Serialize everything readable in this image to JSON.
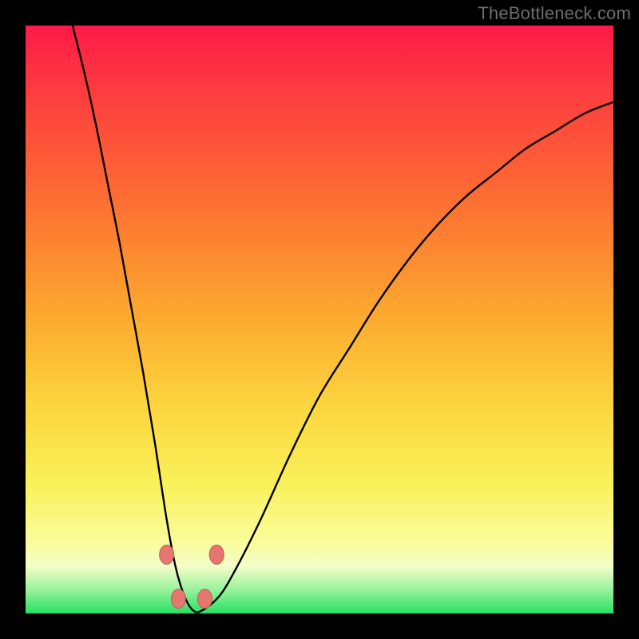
{
  "watermark": "TheBottleneck.com",
  "colors": {
    "background": "#000000",
    "gradient_top": "#fd1a48",
    "gradient_mid1": "#fd6f32",
    "gradient_mid2": "#fcd63f",
    "gradient_mid3": "#fafc9c",
    "gradient_bottom": "#26e062",
    "curve": "#000000",
    "marker_fill": "#e5776f",
    "marker_stroke": "#c25a54"
  },
  "chart_data": {
    "type": "line",
    "title": "",
    "xlabel": "",
    "ylabel": "",
    "xlim": [
      0,
      100
    ],
    "ylim": [
      0,
      100
    ],
    "note": "Axes have no visible tick labels in the image; values below are read from geometry (0–100 normalized).",
    "series": [
      {
        "name": "bottleneck-curve",
        "x": [
          8,
          10,
          12,
          14,
          16,
          18,
          20,
          22,
          24,
          25.5,
          27,
          28.5,
          30,
          33,
          36,
          40,
          45,
          50,
          55,
          60,
          65,
          70,
          75,
          80,
          85,
          90,
          95,
          100
        ],
        "y": [
          100,
          92,
          83,
          73,
          63,
          52,
          41,
          29,
          16,
          8,
          3,
          0.5,
          0.5,
          3,
          8,
          16,
          27,
          37,
          45,
          53,
          60,
          66,
          71,
          75,
          79,
          82,
          85,
          87
        ]
      }
    ],
    "markers": [
      {
        "name": "left-upper-marker",
        "x": 24.0,
        "y": 10.0
      },
      {
        "name": "right-upper-marker",
        "x": 32.5,
        "y": 10.0
      },
      {
        "name": "left-lower-marker",
        "x": 26.0,
        "y": 2.5
      },
      {
        "name": "right-lower-marker",
        "x": 30.5,
        "y": 2.5
      }
    ]
  }
}
